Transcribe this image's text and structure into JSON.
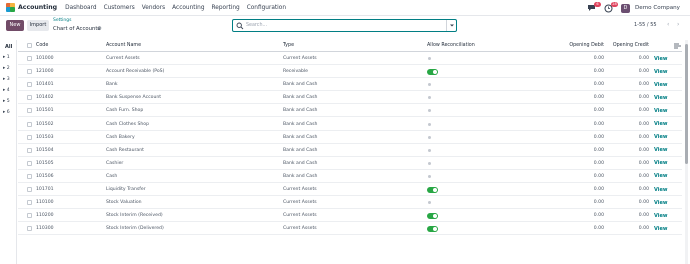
{
  "app": {
    "name": "Accounting"
  },
  "menu": [
    "Dashboard",
    "Customers",
    "Vendors",
    "Accounting",
    "Reporting",
    "Configuration"
  ],
  "topbar": {
    "chat_badge": "6",
    "activity_badge": "28",
    "avatar_letter": "D",
    "company": "Demo Company"
  },
  "control": {
    "new_label": "New",
    "import_label": "Import",
    "breadcrumb_parent": "Settings",
    "breadcrumb_title": "Chart of Accounts",
    "search_placeholder": "Search...",
    "pager": "1-55 / 55"
  },
  "side_groups": {
    "all": "All",
    "items": [
      "1",
      "2",
      "3",
      "4",
      "5",
      "6"
    ]
  },
  "table": {
    "columns": {
      "code": "Code",
      "name": "Account Name",
      "type": "Type",
      "reconcile": "Allow Reconciliation",
      "debit": "Opening Debit",
      "credit": "Opening Credit"
    },
    "view_label": "View",
    "rows": [
      {
        "code": "101000",
        "name": "Current Assets",
        "type": "Current Assets",
        "reconcile": false,
        "debit": "0.00",
        "credit": "0.00"
      },
      {
        "code": "121000",
        "name": "Account Receivable (PoS)",
        "type": "Receivable",
        "reconcile": true,
        "debit": "0.00",
        "credit": "0.00"
      },
      {
        "code": "101401",
        "name": "Bank",
        "type": "Bank and Cash",
        "reconcile": false,
        "debit": "0.00",
        "credit": "0.00"
      },
      {
        "code": "101402",
        "name": "Bank Suspense Account",
        "type": "Bank and Cash",
        "reconcile": false,
        "debit": "0.00",
        "credit": "0.00"
      },
      {
        "code": "101501",
        "name": "Cash Furn. Shop",
        "type": "Bank and Cash",
        "reconcile": false,
        "debit": "0.00",
        "credit": "0.00"
      },
      {
        "code": "101502",
        "name": "Cash Clothes Shop",
        "type": "Bank and Cash",
        "reconcile": false,
        "debit": "0.00",
        "credit": "0.00"
      },
      {
        "code": "101503",
        "name": "Cash Bakery",
        "type": "Bank and Cash",
        "reconcile": false,
        "debit": "0.00",
        "credit": "0.00"
      },
      {
        "code": "101504",
        "name": "Cash Restaurant",
        "type": "Bank and Cash",
        "reconcile": false,
        "debit": "0.00",
        "credit": "0.00"
      },
      {
        "code": "101505",
        "name": "Cashier",
        "type": "Bank and Cash",
        "reconcile": false,
        "debit": "0.00",
        "credit": "0.00"
      },
      {
        "code": "101506",
        "name": "Cash",
        "type": "Bank and Cash",
        "reconcile": false,
        "debit": "0.00",
        "credit": "0.00"
      },
      {
        "code": "101701",
        "name": "Liquidity Transfer",
        "type": "Current Assets",
        "reconcile": true,
        "debit": "0.00",
        "credit": "0.00"
      },
      {
        "code": "110100",
        "name": "Stock Valuation",
        "type": "Current Assets",
        "reconcile": false,
        "debit": "0.00",
        "credit": "0.00"
      },
      {
        "code": "110200",
        "name": "Stock Interim (Received)",
        "type": "Current Assets",
        "reconcile": true,
        "debit": "0.00",
        "credit": "0.00"
      },
      {
        "code": "110300",
        "name": "Stock Interim (Delivered)",
        "type": "Current Assets",
        "reconcile": true,
        "debit": "0.00",
        "credit": "0.00"
      }
    ]
  },
  "colors": {
    "brand": "#714b67",
    "accent": "#017e84",
    "toggle_on": "#28a745",
    "badge": "#e0435d"
  }
}
